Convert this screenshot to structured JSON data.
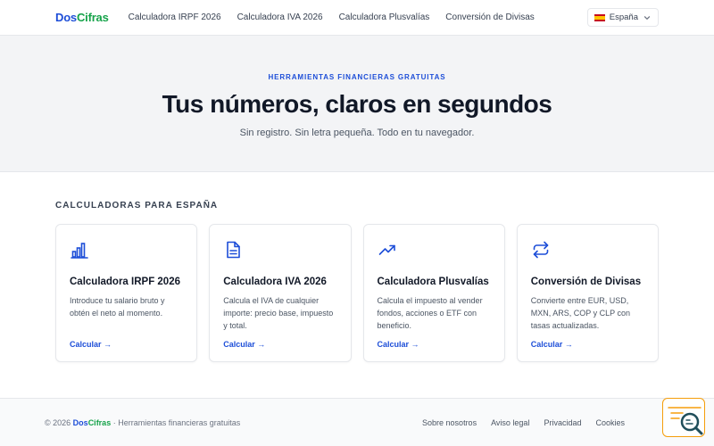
{
  "nav": {
    "logo_part1": "Dos",
    "logo_part2": "Cifras",
    "links": [
      "Calculadora IRPF 2026",
      "Calculadora IVA 2026",
      "Calculadora Plusvalías",
      "Conversión de Divisas"
    ],
    "language": "España"
  },
  "hero": {
    "eyebrow": "HERRAMIENTAS FINANCIERAS GRATUITAS",
    "title": "Tus números, claros en segundos",
    "subtitle": "Sin registro. Sin letra pequeña. Todo en tu navegador."
  },
  "section": {
    "title": "CALCULADORAS PARA ESPAÑA",
    "cards": [
      {
        "icon": "bar-chart-icon",
        "title": "Calculadora IRPF 2026",
        "desc": "Introduce tu salario bruto y obtén el neto al momento.",
        "cta": "Calcular →"
      },
      {
        "icon": "document-icon",
        "title": "Calculadora IVA 2026",
        "desc": "Calcula el IVA de cualquier importe: precio base, impuesto y total.",
        "cta": "Calcular →"
      },
      {
        "icon": "trending-up-icon",
        "title": "Calculadora Plusvalías",
        "desc": "Calcula el impuesto al vender fondos, acciones o ETF con beneficio.",
        "cta": "Calcular →"
      },
      {
        "icon": "exchange-icon",
        "title": "Conversión de Divisas",
        "desc": "Convierte entre EUR, USD, MXN, ARS, COP y CLP con tasas actualizadas.",
        "cta": "Calcular →"
      }
    ]
  },
  "footer": {
    "copyright": "© 2026",
    "brand_part1": "Dos",
    "brand_part2": "Cifras",
    "tagline": "· Herramientas financieras gratuitas",
    "links": [
      "Sobre nosotros",
      "Aviso legal",
      "Privacidad",
      "Cookies"
    ]
  },
  "colors": {
    "brand_blue": "#1d4ed8",
    "brand_green": "#16a34a",
    "widget_orange": "#f59e0b"
  }
}
